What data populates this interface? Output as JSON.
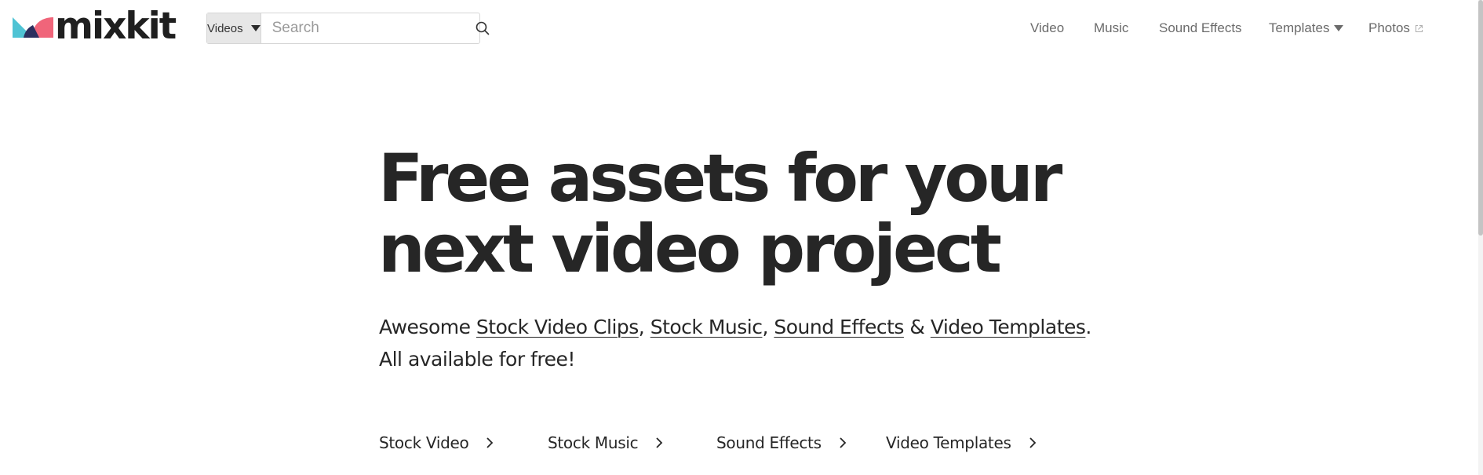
{
  "header": {
    "logo_text": "mixkit",
    "search": {
      "type_label": "Videos",
      "placeholder": "Search"
    },
    "nav": {
      "video": "Video",
      "music": "Music",
      "sound_effects": "Sound Effects",
      "templates": "Templates",
      "photos": "Photos"
    }
  },
  "hero": {
    "title_line1": "Free assets for your",
    "title_line2": "next video project",
    "subtitle": {
      "prefix": "Awesome ",
      "link1": "Stock Video Clips",
      "sep1": ", ",
      "link2": "Stock Music",
      "sep2": ", ",
      "link3": "Sound Effects",
      "sep3": " & ",
      "link4": "Video Templates",
      "suffix": ".",
      "line2": "All available for free!"
    },
    "categories": [
      {
        "label": "Stock Video"
      },
      {
        "label": "Stock Music"
      },
      {
        "label": "Sound Effects"
      },
      {
        "label": "Video Templates"
      }
    ]
  },
  "colors": {
    "logo_teal": "#4fc3d4",
    "logo_pink": "#f0657a",
    "logo_navy": "#2b2f5e",
    "text_dark": "#262626",
    "nav_gray": "#6b6b6b"
  }
}
